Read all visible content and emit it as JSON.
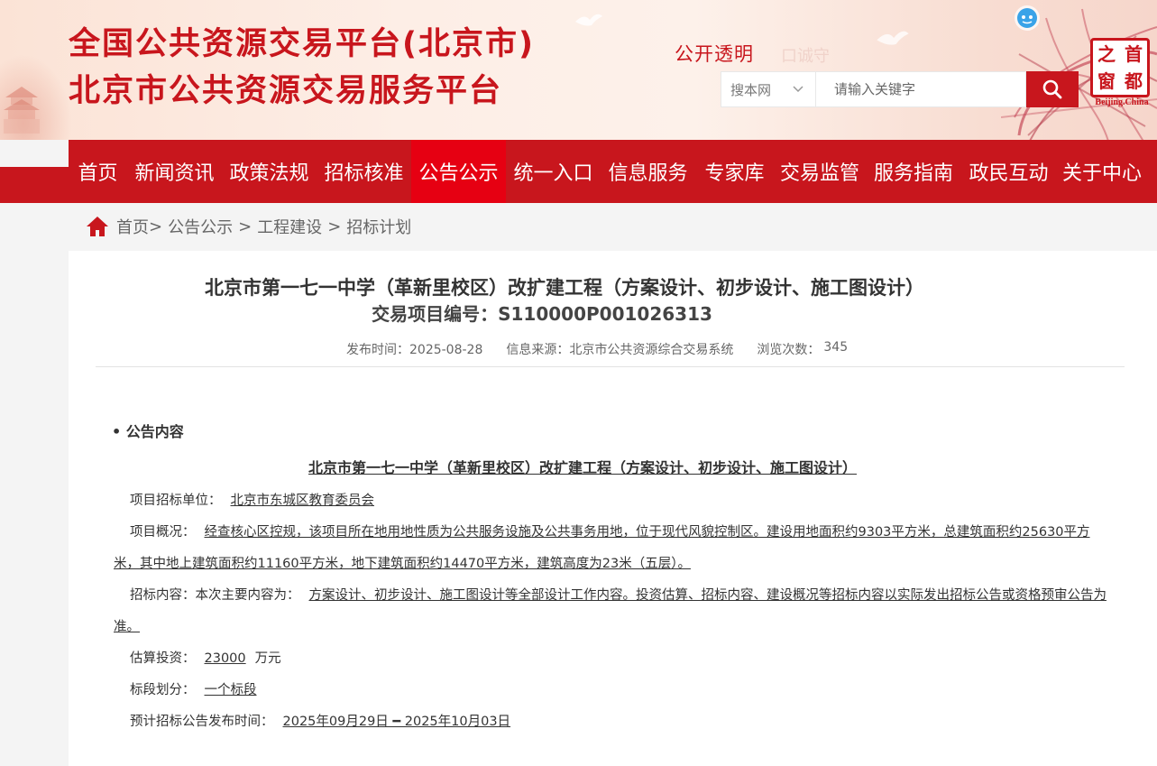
{
  "header": {
    "title_line1": "全国公共资源交易平台(北京市)",
    "title_line2": "北京市公共资源交易服务平台",
    "slogan": "公开透明",
    "faded_text": "口诚守",
    "seal": {
      "chars": [
        "首",
        "之",
        "都",
        "窗"
      ],
      "english": "Beijing.China"
    }
  },
  "search": {
    "scope_selected": "搜本网",
    "placeholder": "请输入关键字"
  },
  "nav": {
    "items": [
      {
        "label": "首页"
      },
      {
        "label": "新闻资讯"
      },
      {
        "label": "政策法规"
      },
      {
        "label": "招标核准"
      },
      {
        "label": "公告公示"
      },
      {
        "label": "统一入口"
      },
      {
        "label": "信息服务"
      },
      {
        "label": "专家库"
      },
      {
        "label": "交易监管"
      },
      {
        "label": "服务指南"
      },
      {
        "label": "政民互动"
      },
      {
        "label": "关于中心"
      }
    ],
    "active_index": 4
  },
  "breadcrumb": {
    "items": [
      "首页",
      "公告公示",
      "工程建设",
      "招标计划"
    ],
    "separator": ">"
  },
  "article": {
    "title": "北京市第一七一中学（革新里校区）改扩建工程（方案设计、初步设计、施工图设计）",
    "code": "交易项目编号：S110000P001026313",
    "publish": "发布时间：2025-08-28",
    "source": "信息来源：北京市公共资源综合交易系统",
    "views_label": "浏览次数：",
    "views": "345",
    "section_heading": "• 公告内容",
    "inner_title": "北京市第一七一中学（革新里校区）改扩建工程（方案设计、初步设计、施工图设计）",
    "unit_label": "项目招标单位：",
    "unit_value": "北京市东城区教育委员会",
    "overview_label": "项目概况：",
    "overview_value": "经查核心区控规，该项目所在地用地性质为公共服务设施及公共事务用地，位于现代风貌控制区。建设用地面积约9303平方米，总建筑面积约25630平方米，其中地上建筑面积约11160平方米，地下建筑面积约14470平方米，建筑高度为23米（五层）。",
    "content_label": "招标内容：本次主要内容为：",
    "content_value": "方案设计、初步设计、施工图设计等全部设计工作内容。投资估算、招标内容、建设概况等招标内容以实际发出招标公告或资格预审公告为准。",
    "investment_label": "估算投资：",
    "investment_value": "23000",
    "investment_unit": "万元",
    "section_label": "标段划分：",
    "section_value": "一个标段",
    "time_label": "预计招标公告发布时间：",
    "time_value": "2025年09月29日 ━ 2025年10月03日"
  },
  "colors": {
    "brand_red": "#c8161d",
    "active_red": "#e60012"
  }
}
